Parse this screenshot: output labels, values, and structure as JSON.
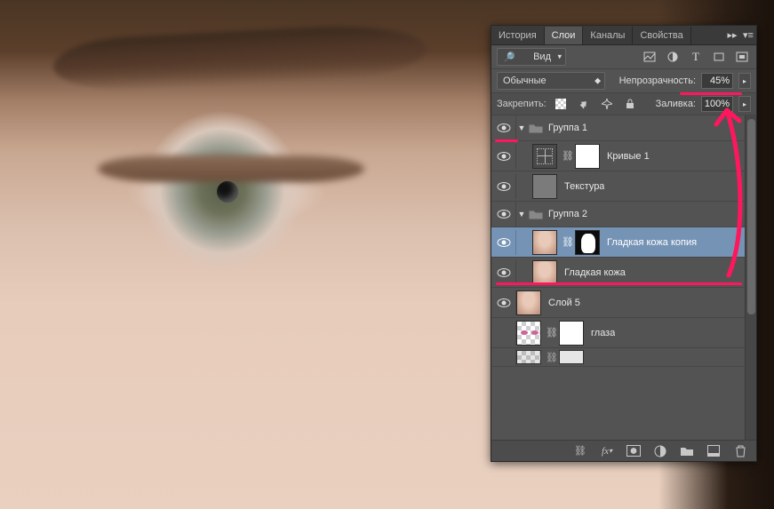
{
  "tabs": {
    "history": "История",
    "layers": "Слои",
    "channels": "Каналы",
    "properties": "Свойства"
  },
  "filter": {
    "label": "Вид"
  },
  "blend": {
    "mode": "Обычные",
    "opacity_label": "Непрозрачность:",
    "opacity_value": "45%"
  },
  "lock": {
    "label": "Закрепить:",
    "fill_label": "Заливка:",
    "fill_value": "100%"
  },
  "layers_list": [
    {
      "kind": "group",
      "name": "Группа 1",
      "expanded": true,
      "visible": true,
      "depth": 0
    },
    {
      "kind": "adjustment",
      "name": "Кривые 1",
      "visible": true,
      "depth": 1,
      "thumbs": [
        "curves",
        "link",
        "white"
      ]
    },
    {
      "kind": "layer",
      "name": "Текстура",
      "visible": true,
      "depth": 1,
      "thumbs": [
        "texture"
      ]
    },
    {
      "kind": "group",
      "name": "Группа 2",
      "expanded": true,
      "visible": true,
      "depth": 0
    },
    {
      "kind": "layer",
      "name": "Гладкая кожа копия",
      "visible": true,
      "depth": 1,
      "selected": true,
      "thumbs": [
        "skin",
        "link",
        "mask"
      ]
    },
    {
      "kind": "layer",
      "name": "Гладкая кожа",
      "visible": true,
      "depth": 1,
      "thumbs": [
        "skin"
      ]
    },
    {
      "kind": "layer",
      "name": "Слой 5",
      "visible": true,
      "depth": 0,
      "thumbs": [
        "skin"
      ]
    },
    {
      "kind": "layer",
      "name": "глаза",
      "visible": false,
      "depth": 0,
      "thumbs": [
        "checker-eyes",
        "link",
        "white"
      ]
    },
    {
      "kind": "layer",
      "name": "",
      "visible": false,
      "depth": 0,
      "thumbs": [
        "checker",
        "link",
        "white"
      ],
      "truncated": true
    }
  ],
  "icons": {
    "filter_image": "image-filter",
    "filter_adjust": "adjust-filter",
    "filter_type": "type-filter",
    "filter_shape": "shape-filter",
    "filter_smart": "smart-filter"
  },
  "bottom": {
    "link": "link-layers",
    "fx": "fx",
    "mask": "add-mask",
    "adjust": "new-adjustment",
    "group": "new-group",
    "new": "new-layer",
    "trash": "delete-layer"
  }
}
